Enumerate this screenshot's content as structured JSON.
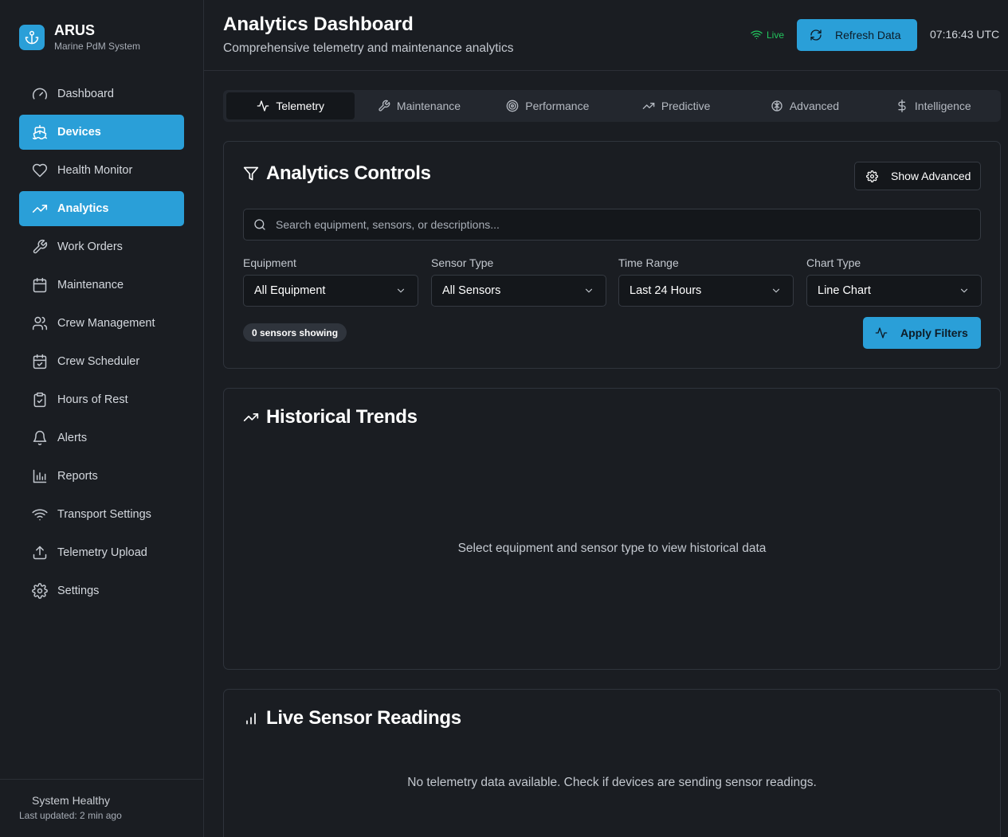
{
  "brand": {
    "name": "ARUS",
    "subtitle": "Marine PdM System"
  },
  "sidebar": {
    "items": [
      {
        "label": "Dashboard",
        "icon": "gauge-icon"
      },
      {
        "label": "Devices",
        "icon": "ship-icon"
      },
      {
        "label": "Health Monitor",
        "icon": "heart-icon"
      },
      {
        "label": "Analytics",
        "icon": "trending-up-icon"
      },
      {
        "label": "Work Orders",
        "icon": "wrench-icon"
      },
      {
        "label": "Maintenance",
        "icon": "calendar-icon"
      },
      {
        "label": "Crew Management",
        "icon": "users-icon"
      },
      {
        "label": "Crew Scheduler",
        "icon": "calendar-check-icon"
      },
      {
        "label": "Hours of Rest",
        "icon": "clipboard-icon"
      },
      {
        "label": "Alerts",
        "icon": "bell-icon"
      },
      {
        "label": "Reports",
        "icon": "bar-chart-icon"
      },
      {
        "label": "Transport Settings",
        "icon": "wifi-icon"
      },
      {
        "label": "Telemetry Upload",
        "icon": "upload-icon"
      },
      {
        "label": "Settings",
        "icon": "settings-icon"
      }
    ],
    "footer": {
      "status": "System Healthy",
      "updated": "Last updated: 2 min ago"
    }
  },
  "header": {
    "title": "Analytics Dashboard",
    "subtitle": "Comprehensive telemetry and maintenance analytics",
    "live_label": "Live",
    "refresh_label": "Refresh Data",
    "clock": "07:16:43 UTC"
  },
  "tabs": [
    {
      "label": "Telemetry",
      "icon": "activity-icon"
    },
    {
      "label": "Maintenance",
      "icon": "wrench-icon"
    },
    {
      "label": "Performance",
      "icon": "target-icon"
    },
    {
      "label": "Predictive",
      "icon": "trending-up-icon"
    },
    {
      "label": "Advanced",
      "icon": "brain-icon"
    },
    {
      "label": "Intelligence",
      "icon": "dollar-icon"
    }
  ],
  "controls": {
    "title": "Analytics Controls",
    "show_advanced": "Show Advanced",
    "search_placeholder": "Search equipment, sensors, or descriptions...",
    "filters": [
      {
        "label": "Equipment",
        "value": "All Equipment"
      },
      {
        "label": "Sensor Type",
        "value": "All Sensors"
      },
      {
        "label": "Time Range",
        "value": "Last 24 Hours"
      },
      {
        "label": "Chart Type",
        "value": "Line Chart"
      }
    ],
    "sensor_count": "0 sensors showing",
    "apply_label": "Apply Filters"
  },
  "trends": {
    "title": "Historical Trends",
    "empty": "Select equipment and sensor type to view historical data"
  },
  "live_readings": {
    "title": "Live Sensor Readings",
    "empty": "No telemetry data available. Check if devices are sending sensor readings."
  },
  "colors": {
    "accent": "#2a9fd8",
    "live": "#22c55e",
    "background": "#1a1d22"
  }
}
